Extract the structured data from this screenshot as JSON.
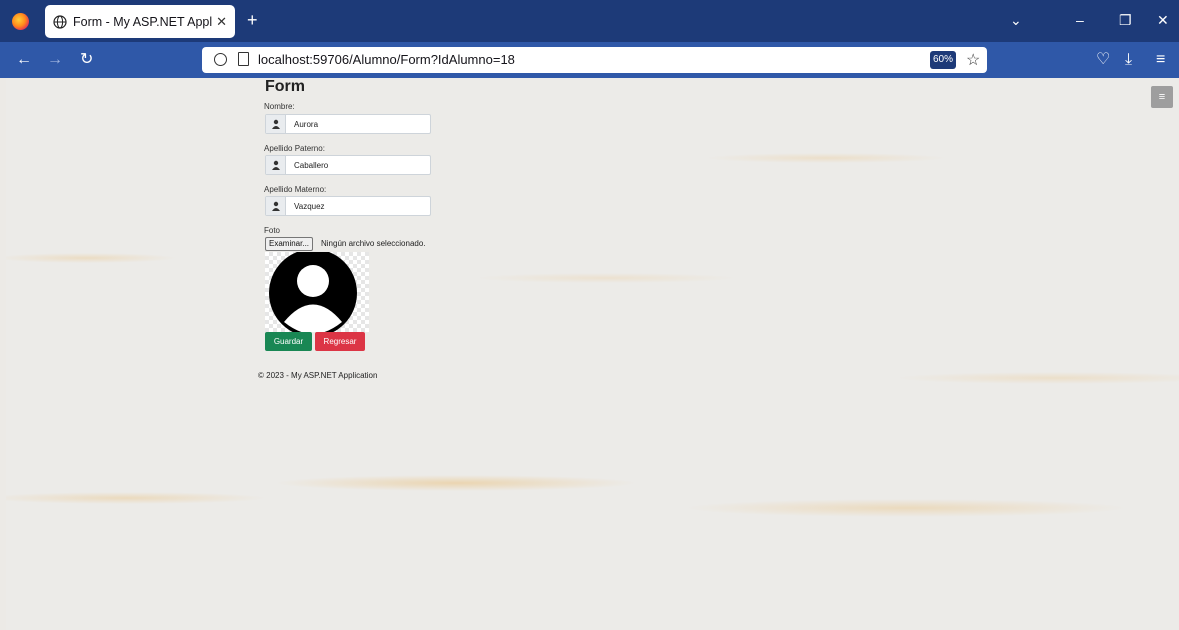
{
  "browser": {
    "tab_title": "Form - My ASP.NET Application",
    "url": "localhost:59706/Alumno/Form?IdAlumno=18",
    "zoom": "60%"
  },
  "form": {
    "title": "Form",
    "nombre_label": "Nombre:",
    "nombre_value": "Aurora",
    "apellido_paterno_label": "Apellido Paterno:",
    "apellido_paterno_value": "Caballero",
    "apellido_materno_label": "Apellido Materno:",
    "apellido_materno_value": "Vazquez",
    "foto_label": "Foto",
    "file_button": "Examinar...",
    "file_status": "Ningún archivo seleccionado.",
    "save_button": "Guardar",
    "back_button": "Regresar"
  },
  "footer": {
    "text": "© 2023 - My ASP.NET Application"
  },
  "colors": {
    "save": "#198754",
    "back": "#dc3545",
    "tabbar": "#1d3a78",
    "navbar": "#2f58a8"
  }
}
